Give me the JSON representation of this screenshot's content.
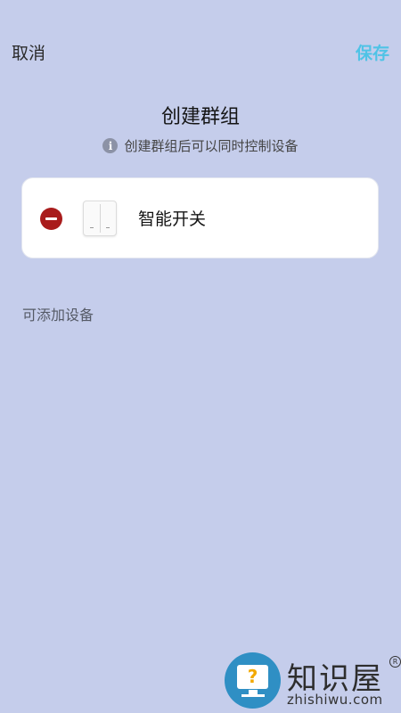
{
  "header": {
    "cancel_label": "取消",
    "save_label": "保存",
    "title": "创建群组",
    "hint": "创建群组后可以同时控制设备"
  },
  "group_devices": [
    {
      "name": "智能开关",
      "icon": "smart-switch-icon"
    }
  ],
  "available_section": {
    "label": "可添加设备"
  },
  "watermark": {
    "name_cn": "知识屋",
    "name_en": "zhishiwu.com",
    "registered_mark": "R"
  },
  "colors": {
    "background": "#c5cdeb",
    "accent": "#4fc3e6",
    "remove": "#a91c1c",
    "card": "#ffffff"
  }
}
